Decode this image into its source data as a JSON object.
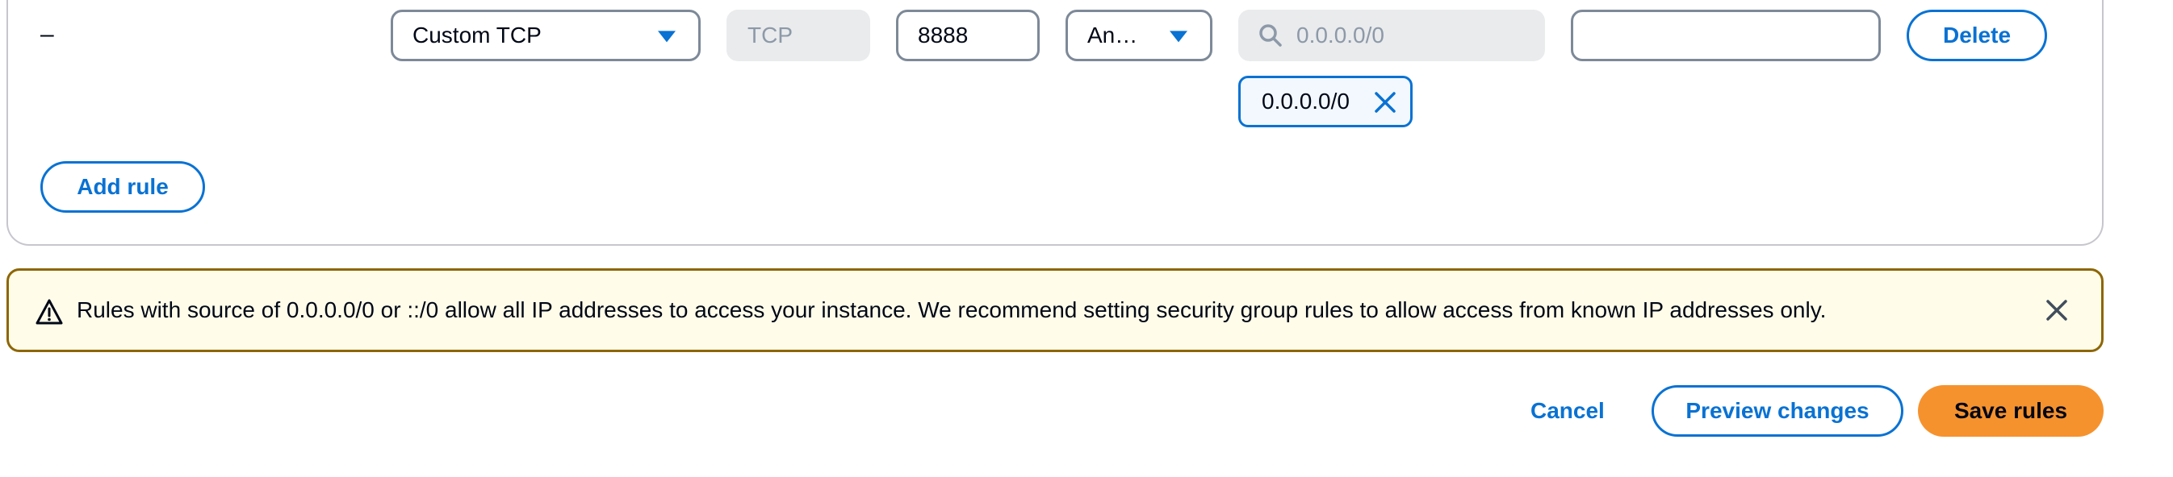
{
  "rule": {
    "dash": "–",
    "type_value": "Custom TCP",
    "protocol_value": "TCP",
    "port_value": "8888",
    "source_type_value": "An…",
    "source_search_placeholder": "0.0.0.0/0",
    "source_token": "0.0.0.0/0",
    "description_value": "",
    "delete_label": "Delete"
  },
  "add_rule_label": "Add rule",
  "alert": {
    "type": "warning",
    "text": "Rules with source of 0.0.0.0/0 or ::/0 allow all IP addresses to access your instance. We recommend setting security group rules to allow access from known IP addresses only."
  },
  "footer": {
    "cancel_label": "Cancel",
    "preview_label": "Preview changes",
    "save_label": "Save rules"
  },
  "colors": {
    "accent": "#0972d3",
    "primary_button": "#f6922d",
    "warning_border": "#8d6605",
    "warning_bg": "#fffce9"
  },
  "icons": {
    "type_dropdown": "caret-down-icon",
    "source_search": "search-icon",
    "token_remove": "close-icon",
    "alert": "warning-icon",
    "alert_dismiss": "close-icon"
  }
}
